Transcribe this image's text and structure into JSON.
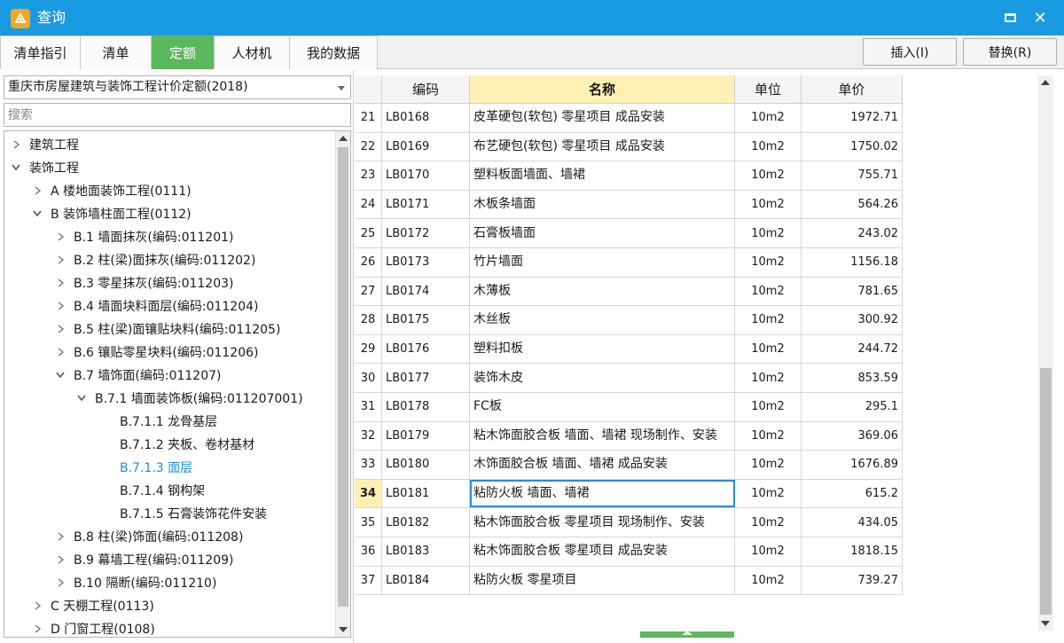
{
  "window": {
    "title": "查询",
    "minimize_icon": "maximize-icon",
    "close_label": "✕"
  },
  "tabs": [
    {
      "label": "清单指引",
      "active": false
    },
    {
      "label": "清单",
      "active": false
    },
    {
      "label": "定额",
      "active": true
    },
    {
      "label": "人材机",
      "active": false
    },
    {
      "label": "我的数据",
      "active": false
    }
  ],
  "actions": {
    "insert_label": "插入(I)",
    "replace_label": "替换(R)"
  },
  "library": {
    "selected": "重庆市房屋建筑与装饰工程计价定额(2018)"
  },
  "search": {
    "placeholder": "搜索",
    "value": ""
  },
  "tree": [
    {
      "label": "建筑工程",
      "level": 0,
      "state": "collapsed",
      "selected": false
    },
    {
      "label": "装饰工程",
      "level": 0,
      "state": "expanded",
      "selected": false
    },
    {
      "label": "A 楼地面装饰工程(0111)",
      "level": 1,
      "state": "collapsed",
      "selected": false
    },
    {
      "label": "B 装饰墙柱面工程(0112)",
      "level": 1,
      "state": "expanded",
      "selected": false
    },
    {
      "label": "B.1 墙面抹灰(编码:011201)",
      "level": 2,
      "state": "collapsed",
      "selected": false
    },
    {
      "label": "B.2 柱(梁)面抹灰(编码:011202)",
      "level": 2,
      "state": "collapsed",
      "selected": false
    },
    {
      "label": "B.3 零星抹灰(编码:011203)",
      "level": 2,
      "state": "collapsed",
      "selected": false
    },
    {
      "label": "B.4 墙面块料面层(编码:011204)",
      "level": 2,
      "state": "collapsed",
      "selected": false
    },
    {
      "label": "B.5 柱(梁)面镶贴块料(编码:011205)",
      "level": 2,
      "state": "collapsed",
      "selected": false
    },
    {
      "label": "B.6 镶贴零星块料(编码:011206)",
      "level": 2,
      "state": "collapsed",
      "selected": false
    },
    {
      "label": "B.7 墙饰面(编码:011207)",
      "level": 2,
      "state": "expanded",
      "selected": false
    },
    {
      "label": "B.7.1 墙面装饰板(编码:011207001)",
      "level": 3,
      "state": "expanded",
      "selected": false
    },
    {
      "label": "B.7.1.1 龙骨基层",
      "level": 4,
      "state": "leaf",
      "selected": false
    },
    {
      "label": "B.7.1.2 夹板、卷材基材",
      "level": 4,
      "state": "leaf",
      "selected": false
    },
    {
      "label": "B.7.1.3 面层",
      "level": 4,
      "state": "leaf",
      "selected": true
    },
    {
      "label": "B.7.1.4 钢构架",
      "level": 4,
      "state": "leaf",
      "selected": false
    },
    {
      "label": "B.7.1.5 石膏装饰花件安装",
      "level": 4,
      "state": "leaf",
      "selected": false
    },
    {
      "label": "B.8 柱(梁)饰面(编码:011208)",
      "level": 2,
      "state": "collapsed",
      "selected": false
    },
    {
      "label": "B.9 幕墙工程(编码:011209)",
      "level": 2,
      "state": "collapsed",
      "selected": false
    },
    {
      "label": "B.10 隔断(编码:011210)",
      "level": 2,
      "state": "collapsed",
      "selected": false
    },
    {
      "label": "C 天棚工程(0113)",
      "level": 1,
      "state": "collapsed",
      "selected": false
    },
    {
      "label": "D 门窗工程(0108)",
      "level": 1,
      "state": "collapsed",
      "selected": false
    }
  ],
  "grid": {
    "headers": {
      "num": "",
      "code": "编码",
      "name": "名称",
      "unit": "单位",
      "price": "单价"
    },
    "selected_row": 34,
    "rows": [
      {
        "num": "21",
        "code": "LB0168",
        "name": "皮革硬包(软包) 零星项目 成品安装",
        "unit": "10m2",
        "price": "1972.71"
      },
      {
        "num": "22",
        "code": "LB0169",
        "name": "布艺硬包(软包) 零星项目 成品安装",
        "unit": "10m2",
        "price": "1750.02"
      },
      {
        "num": "23",
        "code": "LB0170",
        "name": "塑料板面墙面、墙裙",
        "unit": "10m2",
        "price": "755.71"
      },
      {
        "num": "24",
        "code": "LB0171",
        "name": "木板条墙面",
        "unit": "10m2",
        "price": "564.26"
      },
      {
        "num": "25",
        "code": "LB0172",
        "name": "石膏板墙面",
        "unit": "10m2",
        "price": "243.02"
      },
      {
        "num": "26",
        "code": "LB0173",
        "name": "竹片墙面",
        "unit": "10m2",
        "price": "1156.18"
      },
      {
        "num": "27",
        "code": "LB0174",
        "name": "木薄板",
        "unit": "10m2",
        "price": "781.65"
      },
      {
        "num": "28",
        "code": "LB0175",
        "name": "木丝板",
        "unit": "10m2",
        "price": "300.92"
      },
      {
        "num": "29",
        "code": "LB0176",
        "name": "塑料扣板",
        "unit": "10m2",
        "price": "244.72"
      },
      {
        "num": "30",
        "code": "LB0177",
        "name": "装饰木皮",
        "unit": "10m2",
        "price": "853.59"
      },
      {
        "num": "31",
        "code": "LB0178",
        "name": "FC板",
        "unit": "10m2",
        "price": "295.1"
      },
      {
        "num": "32",
        "code": "LB0179",
        "name": "粘木饰面胶合板 墙面、墙裙 现场制作、安装",
        "unit": "10m2",
        "price": "369.06"
      },
      {
        "num": "33",
        "code": "LB0180",
        "name": "木饰面胶合板 墙面、墙裙 成品安装",
        "unit": "10m2",
        "price": "1676.89"
      },
      {
        "num": "34",
        "code": "LB0181",
        "name": "粘防火板 墙面、墙裙",
        "unit": "10m2",
        "price": "615.2"
      },
      {
        "num": "35",
        "code": "LB0182",
        "name": "粘木饰面胶合板 零星项目 现场制作、安装",
        "unit": "10m2",
        "price": "434.05"
      },
      {
        "num": "36",
        "code": "LB0183",
        "name": "粘木饰面胶合板 零星项目 成品安装",
        "unit": "10m2",
        "price": "1818.15"
      },
      {
        "num": "37",
        "code": "LB0184",
        "name": "粘防火板 零星项目",
        "unit": "10m2",
        "price": "739.27"
      }
    ]
  },
  "colors": {
    "titlebar": "#1a9ae0",
    "tab_active": "#5cb85c",
    "header_highlight": "#fff0b3",
    "tree_selected": "#1a8fe0",
    "row_selected_border": "#2b8ad8"
  }
}
